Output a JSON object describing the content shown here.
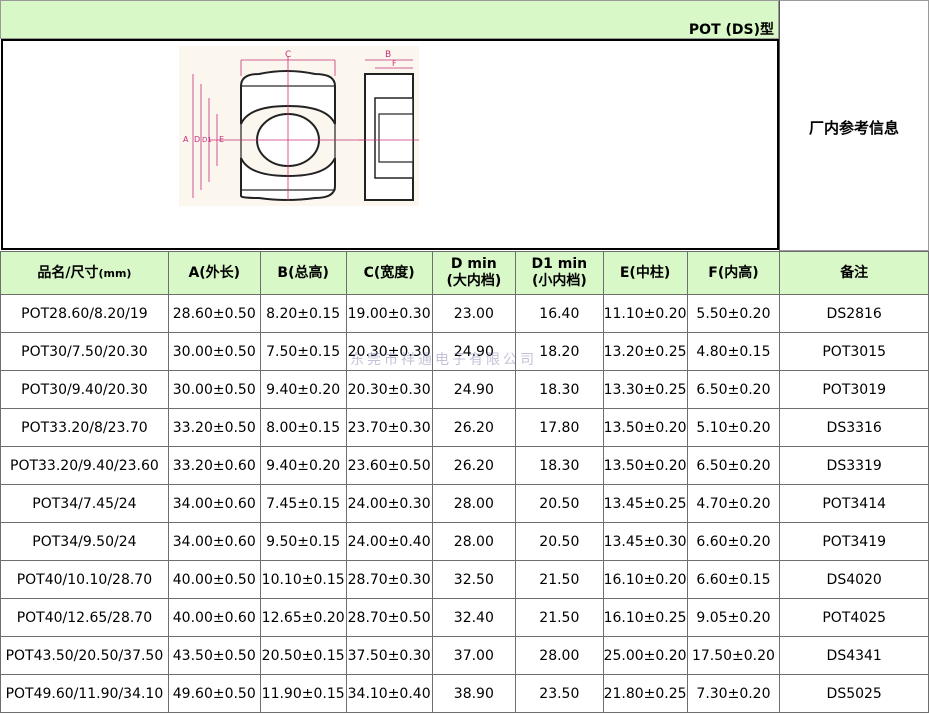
{
  "header": {
    "title": "POT (DS)型",
    "reference_label": "厂内参考信息"
  },
  "diagram": {
    "labels": [
      "C",
      "B",
      "F",
      "A",
      "D",
      "D1",
      "E"
    ]
  },
  "table": {
    "columns": [
      {
        "label": "品名/尺寸",
        "unit": "(mm)"
      },
      {
        "label": "A(外长)"
      },
      {
        "label": "B(总高)"
      },
      {
        "label": "C(宽度)"
      },
      {
        "label": "D min",
        "sub": "(大内档)"
      },
      {
        "label": "D1 min",
        "sub": "(小内档)"
      },
      {
        "label": "E(中柱)"
      },
      {
        "label": "F(内高)"
      },
      {
        "label": "备注"
      }
    ],
    "rows": [
      [
        "POT28.60/8.20/19",
        "28.60±0.50",
        "8.20±0.15",
        "19.00±0.30",
        "23.00",
        "16.40",
        "11.10±0.20",
        "5.50±0.20",
        "DS2816"
      ],
      [
        "POT30/7.50/20.30",
        "30.00±0.50",
        "7.50±0.15",
        "20.30±0.30",
        "24.90",
        "18.20",
        "13.20±0.25",
        "4.80±0.15",
        "POT3015"
      ],
      [
        "POT30/9.40/20.30",
        "30.00±0.50",
        "9.40±0.20",
        "20.30±0.30",
        "24.90",
        "18.30",
        "13.30±0.25",
        "6.50±0.20",
        "POT3019"
      ],
      [
        "POT33.20/8/23.70",
        "33.20±0.50",
        "8.00±0.15",
        "23.70±0.30",
        "26.20",
        "17.80",
        "13.50±0.20",
        "5.10±0.20",
        "DS3316"
      ],
      [
        "POT33.20/9.40/23.60",
        "33.20±0.60",
        "9.40±0.20",
        "23.60±0.50",
        "26.20",
        "18.30",
        "13.50±0.20",
        "6.50±0.20",
        "DS3319"
      ],
      [
        "POT34/7.45/24",
        "34.00±0.60",
        "7.45±0.15",
        "24.00±0.30",
        "28.00",
        "20.50",
        "13.45±0.25",
        "4.70±0.20",
        "POT3414"
      ],
      [
        "POT34/9.50/24",
        "34.00±0.60",
        "9.50±0.15",
        "24.00±0.40",
        "28.00",
        "20.50",
        "13.45±0.30",
        "6.60±0.20",
        "POT3419"
      ],
      [
        "POT40/10.10/28.70",
        "40.00±0.50",
        "10.10±0.15",
        "28.70±0.30",
        "32.50",
        "21.50",
        "16.10±0.20",
        "6.60±0.15",
        "DS4020"
      ],
      [
        "POT40/12.65/28.70",
        "40.00±0.60",
        "12.65±0.20",
        "28.70±0.50",
        "32.40",
        "21.50",
        "16.10±0.25",
        "9.05±0.20",
        "POT4025"
      ],
      [
        "POT43.50/20.50/37.50",
        "43.50±0.50",
        "20.50±0.15",
        "37.50±0.30",
        "37.00",
        "28.00",
        "25.00±0.20",
        "17.50±0.20",
        "DS4341"
      ],
      [
        "POT49.60/11.90/34.10",
        "49.60±0.50",
        "11.90±0.15",
        "34.10±0.40",
        "38.90",
        "23.50",
        "21.80±0.25",
        "7.30±0.20",
        "DS5025"
      ]
    ]
  },
  "watermark": "东莞市祥通电子有限公司"
}
